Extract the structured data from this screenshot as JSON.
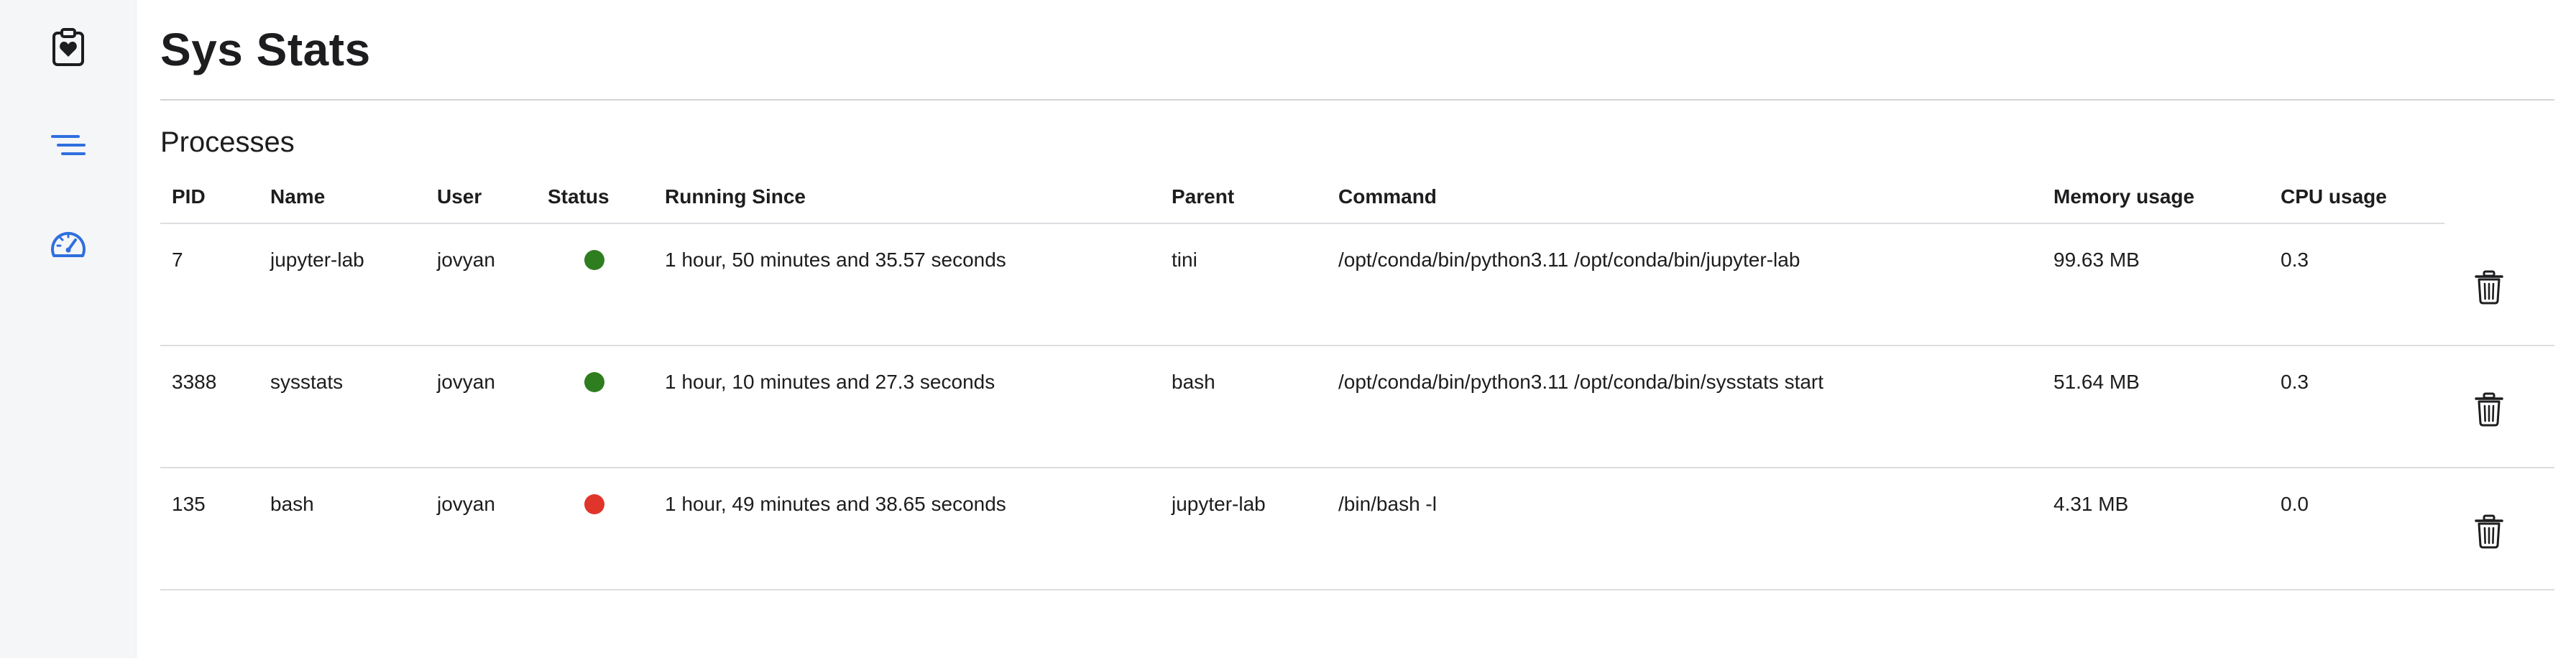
{
  "sidebar": {
    "items": [
      {
        "icon": "clipboard-heart-icon",
        "active": false
      },
      {
        "icon": "list-icon",
        "active": true
      },
      {
        "icon": "speedometer-icon",
        "active": false
      }
    ]
  },
  "header": {
    "title": "Sys Stats"
  },
  "processes": {
    "title": "Processes",
    "columns": {
      "pid": "PID",
      "name": "Name",
      "user": "User",
      "status": "Status",
      "running_since": "Running Since",
      "parent": "Parent",
      "command": "Command",
      "memory": "Memory usage",
      "cpu": "CPU usage"
    },
    "rows": [
      {
        "pid": "7",
        "name": "jupyter-lab",
        "user": "jovyan",
        "status": "running",
        "status_color": "#2e7d1f",
        "running_since": "1 hour, 50 minutes and 35.57 seconds",
        "parent": "tini",
        "command": "/opt/conda/bin/python3.11 /opt/conda/bin/jupyter-lab",
        "memory": "99.63 MB",
        "cpu": "0.3"
      },
      {
        "pid": "3388",
        "name": "sysstats",
        "user": "jovyan",
        "status": "running",
        "status_color": "#2e7d1f",
        "running_since": "1 hour, 10 minutes and 27.3 seconds",
        "parent": "bash",
        "command": "/opt/conda/bin/python3.11 /opt/conda/bin/sysstats start",
        "memory": "51.64 MB",
        "cpu": "0.3"
      },
      {
        "pid": "135",
        "name": "bash",
        "user": "jovyan",
        "status": "stopped",
        "status_color": "#e0352b",
        "running_since": "1 hour, 49 minutes and 38.65 seconds",
        "parent": "jupyter-lab",
        "command": "/bin/bash -l",
        "memory": "4.31 MB",
        "cpu": "0.0"
      }
    ]
  },
  "colors": {
    "accent": "#2f6fde",
    "sidebar_bg": "#f5f6f8",
    "running": "#2e7d1f",
    "stopped": "#e0352b"
  }
}
